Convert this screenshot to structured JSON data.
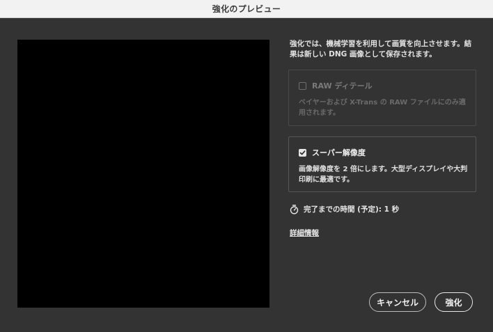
{
  "window": {
    "title": "強化のプレビュー"
  },
  "intro_text": "強化では、機械学習を利用して画質を向上させます。結果は新しい DNG 画像として保存されます。",
  "options": {
    "raw_detail": {
      "label": "RAW ディテール",
      "description": "ベイヤーおよび X-Trans の RAW ファイルにのみ適用されます。",
      "checked": false,
      "enabled": false
    },
    "super_resolution": {
      "label": "スーパー解像度",
      "description": "画像解像度を 2 倍にします。大型ディスプレイや大判印刷に最適です。",
      "checked": true,
      "enabled": true
    }
  },
  "estimate": {
    "icon": "stopwatch-icon",
    "text": "完了までの時間 (予定): 1 秒"
  },
  "learn_more": "詳細情報",
  "buttons": {
    "cancel": "キャンセル",
    "enhance": "強化"
  },
  "colors": {
    "dialog_bg": "#333333",
    "preview_bg": "#000000",
    "titlebar_bg": "#f2f2f2"
  }
}
